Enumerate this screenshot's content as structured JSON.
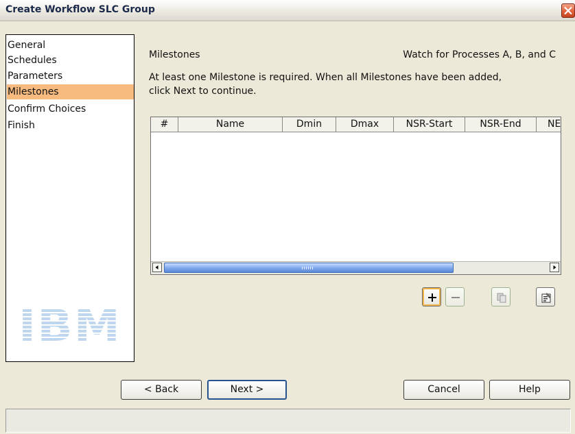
{
  "window": {
    "title": "Create Workflow SLC Group",
    "close_icon": "close-x-icon"
  },
  "nav": {
    "items": [
      {
        "label": "General",
        "selected": false
      },
      {
        "label": "Schedules",
        "selected": false
      },
      {
        "label": "Parameters",
        "selected": false
      },
      {
        "label": "Milestones",
        "selected": true
      },
      {
        "label": "Confirm Choices",
        "selected": false
      },
      {
        "label": "Finish",
        "selected": false
      }
    ],
    "logo_text": "IBM",
    "selected_color": "#f7bb80"
  },
  "main": {
    "section_title": "Milestones",
    "section_subtitle": "Watch for Processes A, B, and C",
    "instructions_line1": "At least one Milestone is required. When all Milestones have been added,",
    "instructions_line2": "click Next to continue."
  },
  "table": {
    "columns": [
      "#",
      "Name",
      "Dmin",
      "Dmax",
      "NSR-Start",
      "NSR-End",
      "NE"
    ],
    "rows": []
  },
  "toolbar": {
    "buttons": [
      {
        "icon": "plus-icon",
        "enabled": true
      },
      {
        "icon": "minus-icon",
        "enabled": false
      },
      {
        "icon": "copy-icon",
        "enabled": false
      },
      {
        "icon": "properties-icon",
        "enabled": true
      }
    ]
  },
  "buttons": {
    "back": "< Back",
    "next": "Next >",
    "cancel": "Cancel",
    "help": "Help"
  },
  "status": {
    "text": ""
  }
}
